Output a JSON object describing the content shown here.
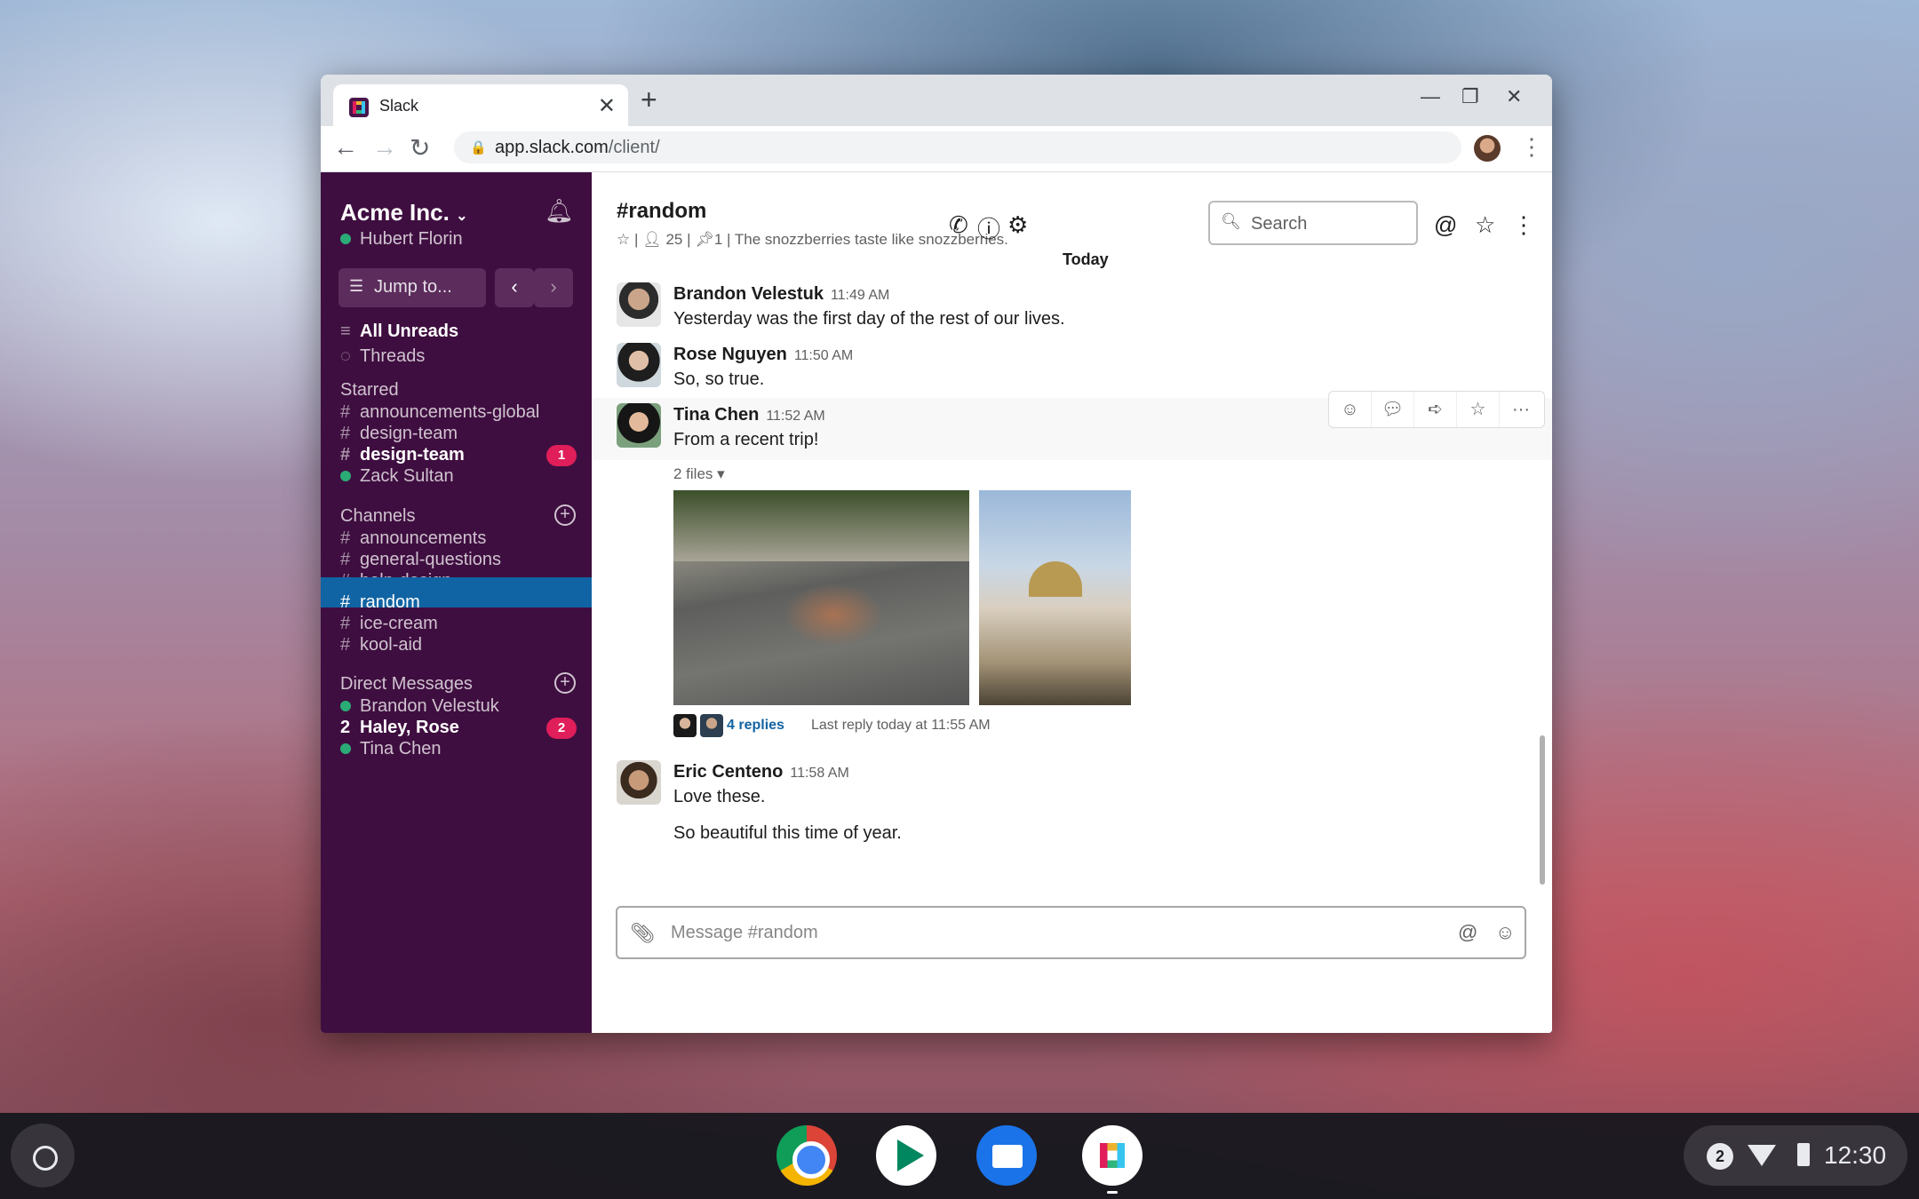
{
  "browser": {
    "tab_title": "Slack",
    "url_host": "app.slack.com",
    "url_path": "/client/"
  },
  "sidebar": {
    "workspace": "Acme Inc.",
    "user": "Hubert Florin",
    "jump_to": "Jump to...",
    "all_unreads": "All Unreads",
    "threads": "Threads",
    "starred_heading": "Starred",
    "starred": [
      {
        "label": "announcements-global",
        "prefix": "#"
      },
      {
        "label": "design-team",
        "prefix": "#"
      },
      {
        "label": "design-team",
        "prefix": "#",
        "badge": "1"
      },
      {
        "label": "Zack Sultan",
        "prefix": "dot"
      }
    ],
    "channels_heading": "Channels",
    "channels": [
      {
        "label": "announcements"
      },
      {
        "label": "general-questions"
      },
      {
        "label": "help-design"
      },
      {
        "label": "random",
        "active": true
      },
      {
        "label": "ice-cream"
      },
      {
        "label": "kool-aid"
      }
    ],
    "dm_heading": "Direct Messages",
    "dms": [
      {
        "label": "Brandon Velestuk"
      },
      {
        "label": "Haley, Rose",
        "prefix": "2",
        "badge": "2"
      },
      {
        "label": "Tina Chen"
      }
    ]
  },
  "channel": {
    "name": "#random",
    "members": "25",
    "pins": "1",
    "topic": "The snozzberries taste like snozzberries.",
    "search_placeholder": "Search",
    "day_divider": "Today"
  },
  "messages": [
    {
      "author": "Brandon Velestuk",
      "time": "11:49 AM",
      "text": "Yesterday was the first day of the rest of our lives."
    },
    {
      "author": "Rose Nguyen",
      "time": "11:50 AM",
      "text": "So, so true."
    },
    {
      "author": "Tina Chen",
      "time": "11:52 AM",
      "text": "From a recent trip!",
      "files_label": "2 files",
      "replies": "4 replies",
      "last_reply": "Last reply today at 11:55 AM"
    },
    {
      "author": "Eric Centeno",
      "time": "11:58 AM",
      "text": "Love these.",
      "text2": "So beautiful this time of year."
    }
  ],
  "composer": {
    "placeholder": "Message #random"
  },
  "shelf": {
    "notification_count": "2",
    "clock": "12:30"
  }
}
